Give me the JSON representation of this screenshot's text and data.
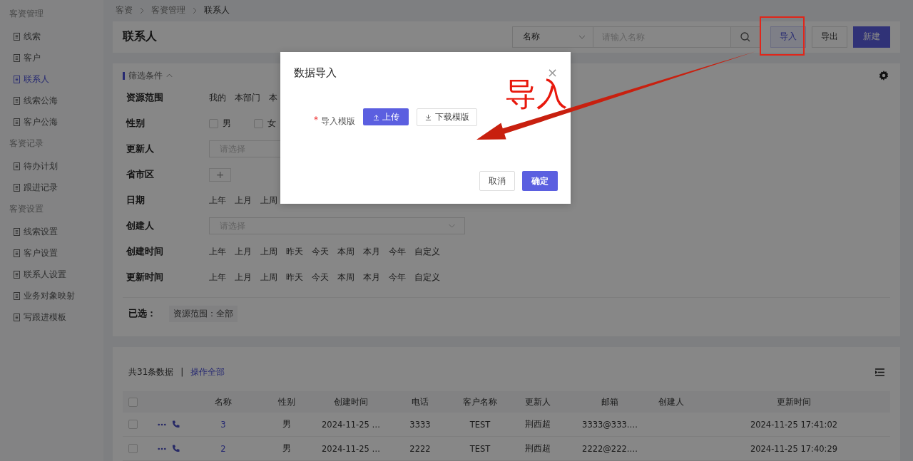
{
  "sidebar": {
    "groups": [
      {
        "title": "客资管理",
        "items": [
          {
            "label": "线索",
            "selected": false
          },
          {
            "label": "客户",
            "selected": false
          },
          {
            "label": "联系人",
            "selected": true
          },
          {
            "label": "线索公海",
            "selected": false
          },
          {
            "label": "客户公海",
            "selected": false
          }
        ]
      },
      {
        "title": "客资记录",
        "items": [
          {
            "label": "待办计划",
            "selected": false
          },
          {
            "label": "跟进记录",
            "selected": false
          }
        ]
      },
      {
        "title": "客资设置",
        "items": [
          {
            "label": "线索设置",
            "selected": false
          },
          {
            "label": "客户设置",
            "selected": false
          },
          {
            "label": "联系人设置",
            "selected": false
          },
          {
            "label": "业务对象映射",
            "selected": false
          },
          {
            "label": "写跟进模板",
            "selected": false
          }
        ]
      }
    ]
  },
  "breadcrumb": [
    "客资",
    "客资管理",
    "联系人"
  ],
  "header": {
    "title": "联系人",
    "search_select": "名称",
    "search": {
      "placeholder": "请输入名称"
    },
    "buttons": [
      {
        "label": "导入",
        "kind": "light"
      },
      {
        "label": "导出",
        "kind": "default"
      },
      {
        "label": "新建",
        "kind": "primary"
      }
    ]
  },
  "filter": {
    "title": "筛选条件",
    "rows": [
      {
        "label": "资源范围",
        "kind": "options",
        "options": [
          "我的",
          "本部门",
          "本"
        ]
      },
      {
        "label": "性别",
        "kind": "checkboxes",
        "options": [
          {
            "label": "男",
            "checked": false
          },
          {
            "label": "女",
            "checked": false
          }
        ]
      },
      {
        "label": "更新人",
        "kind": "select",
        "placeholder": "请选择"
      },
      {
        "label": "省市区",
        "kind": "add",
        "text": "+"
      },
      {
        "label": "日期",
        "kind": "options",
        "options": [
          "上年",
          "上月",
          "上周"
        ]
      },
      {
        "label": "创建人",
        "kind": "select",
        "placeholder": "请选择",
        "wide": true
      },
      {
        "label": "创建时间",
        "kind": "options",
        "options": [
          "上年",
          "上月",
          "上周",
          "昨天",
          "今天",
          "本周",
          "本月",
          "今年",
          "自定义"
        ]
      },
      {
        "label": "更新时间",
        "kind": "options",
        "options": [
          "上年",
          "上月",
          "上周",
          "昨天",
          "今天",
          "本周",
          "本月",
          "今年",
          "自定义"
        ]
      }
    ],
    "selected_label": "已选：",
    "selected_tags": [
      "资源范围：全部"
    ]
  },
  "table": {
    "header_checked": false,
    "count": "共31条数据",
    "separator": "|",
    "action_link": "操作全部",
    "columns": [
      "名称",
      "性别",
      "创建时间",
      "电话",
      "客户名称",
      "更新人",
      "邮箱",
      "创建人",
      "更新时间"
    ],
    "rows": [
      {
        "checked": false,
        "name": "3",
        "gender": "男",
        "created": "2024-11-25 …",
        "phone": "3333",
        "customer": "TEST",
        "updater": "荆西超",
        "email": "3333@333.…",
        "updated": "2024-11-25 17:41:02"
      },
      {
        "checked": false,
        "name": "2",
        "gender": "男",
        "created": "2024-11-25 …",
        "phone": "2222",
        "customer": "TEST",
        "updater": "荆西超",
        "email": "2222@222.…",
        "updated": "2024-11-25 17:40:29"
      }
    ]
  },
  "dialog": {
    "title": "数据导入",
    "close": "×",
    "field_label": "导入模版",
    "required_mark": "*",
    "upload": "上传",
    "download": "下载模版",
    "cancel": "取消",
    "confirm": "确定"
  },
  "annotation": {
    "label": "导入"
  }
}
